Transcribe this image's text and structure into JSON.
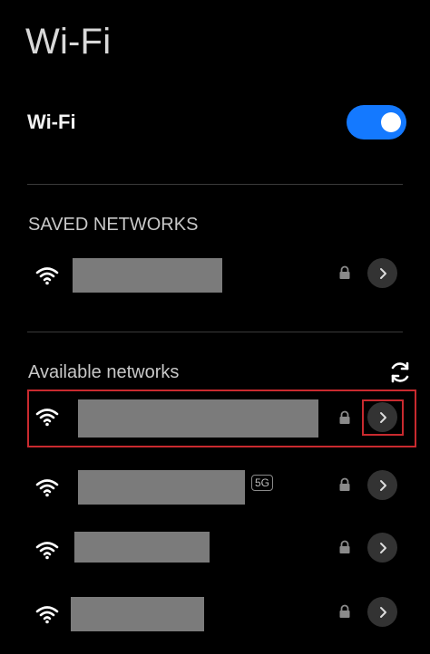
{
  "page": {
    "title": "Wi-Fi"
  },
  "wifi_toggle": {
    "label": "Wi-Fi",
    "enabled": true,
    "accent_color": "#1479FF"
  },
  "sections": {
    "saved": {
      "heading": "SAVED NETWORKS"
    },
    "available": {
      "heading": "Available networks"
    }
  },
  "badges": {
    "band_5g": "5G"
  },
  "icons": {
    "wifi": "wifi-signal-icon",
    "lock": "lock-icon",
    "chevron": "chevron-right-icon",
    "refresh": "refresh-icon"
  },
  "highlight_color": "#C92A2F"
}
